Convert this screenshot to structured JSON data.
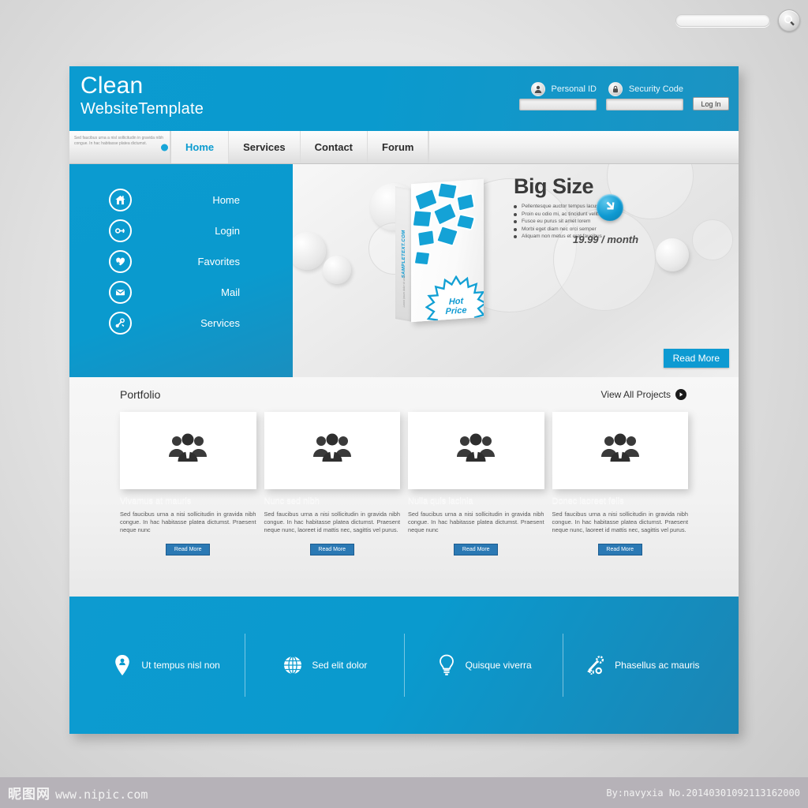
{
  "search": {
    "value": "",
    "placeholder": "",
    "icon": "magnifier-icon"
  },
  "header": {
    "brand_line1": "Clean",
    "brand_line2": "WebsiteTemplate",
    "personal_id_label": "Personal ID",
    "personal_id_value": "",
    "security_code_label": "Security Code",
    "security_code_value": "",
    "login_button": "Log In",
    "accent_color": "#0b9bd0"
  },
  "nav": {
    "blurb": "Sed faucibus urna a nisl sollicitudin in gravida nibh congue. In hac habitasse platea dictumst.",
    "items": [
      {
        "label": "Home",
        "active": true
      },
      {
        "label": "Services",
        "active": false
      },
      {
        "label": "Contact",
        "active": false
      },
      {
        "label": "Forum",
        "active": false
      }
    ]
  },
  "sidebar": {
    "items": [
      {
        "label": "Home",
        "icon": "home-icon"
      },
      {
        "label": "Login",
        "icon": "key-icon"
      },
      {
        "label": "Favorites",
        "icon": "heart-icon"
      },
      {
        "label": "Mail",
        "icon": "envelope-icon"
      },
      {
        "label": "Services",
        "icon": "tools-icon"
      }
    ]
  },
  "hero": {
    "title": "Big Size",
    "bullets": [
      "Pellentesque auctor tempus lacus,",
      "Proin eu odio mi, ac tincidunt velit.",
      "Fusce eu purus sit amet lorem",
      "Morbi eget diam nec orci semper",
      "Aliquam non metus et erat faucibus"
    ],
    "price": "19.99 / month",
    "read_more": "Read More",
    "arrow_icon": "arrow-up-left-icon",
    "box_spine": "SAMPLETEXT.COM",
    "box_spine_sub": "Lorem ipsum dolor sit amet",
    "badge_line1": "Hot",
    "badge_line2": "Price"
  },
  "portfolio": {
    "title": "Portfolio",
    "view_all": "View All Projects",
    "cards": [
      {
        "caption": "Vivamus at mauris",
        "icon": "people-group-icon",
        "text": "Sed faucibus urna a nisi sollicitudin in gravida nibh congue. In hac habitasse platea dictumst. Praesent neque nunc",
        "button": "Read More"
      },
      {
        "caption": "Nunc sed nibh",
        "icon": "people-group-icon",
        "text": "Sed faucibus urna a nisi sollicitudin in gravida nibh congue. In hac habitasse platea dictumst. Praesent neque nunc, laoreet id mattis nec, sagittis vel purus.",
        "button": "Read More"
      },
      {
        "caption": "Nulla quis lacinia",
        "icon": "people-group-icon",
        "text": "Sed faucibus urna a nisi sollicitudin in gravida nibh congue. In hac habitasse platea dictumst. Praesent neque nunc",
        "button": "Read More"
      },
      {
        "caption": "Donec laoreet felis",
        "icon": "people-group-icon",
        "text": "Sed faucibus urna a nisi sollicitudin in gravida nibh congue. In hac habitasse platea dictumst. Praesent neque nunc, laoreet id mattis nec, sagittis vel purus.",
        "button": "Read More"
      }
    ]
  },
  "features": [
    {
      "label": "Ut tempus nisl non",
      "icon": "map-pin-icon"
    },
    {
      "label": "Sed elit dolor",
      "icon": "globe-icon"
    },
    {
      "label": "Quisque viverra",
      "icon": "lightbulb-icon"
    },
    {
      "label": "Phasellus ac mauris",
      "icon": "wrench-gear-icon"
    }
  ],
  "watermark": {
    "cn": "昵图网",
    "url": "www.nipic.com",
    "credit": "By:navyxia  No.20140301092113162000"
  }
}
